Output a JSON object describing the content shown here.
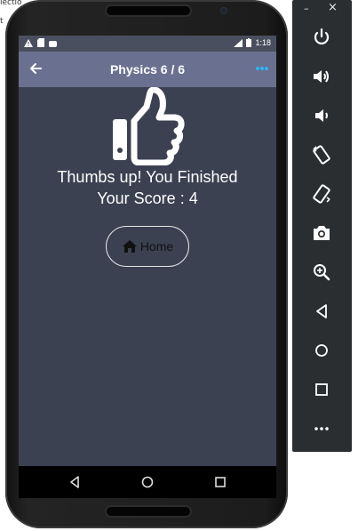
{
  "background": {
    "line1": "lectio",
    "line2": "t"
  },
  "status_bar": {
    "time": "1:18"
  },
  "app_bar": {
    "title": "Physics 6 / 6"
  },
  "result": {
    "message": "Thumbs up! You Finished",
    "score_text": "Your Score : 4"
  },
  "home_button": {
    "label": "Home"
  },
  "emulator_panel": {
    "minimize": "–",
    "close": "×"
  },
  "colors": {
    "screen_bg": "#3b4151",
    "app_bar": "#6a7190",
    "status_bar": "#4a4f5f",
    "accent_more": "#29b6f6"
  },
  "icons": {
    "back": "arrow-left-icon",
    "more": "more-horizontal-icon",
    "result": "thumbs-up-icon",
    "home": "home-icon"
  }
}
